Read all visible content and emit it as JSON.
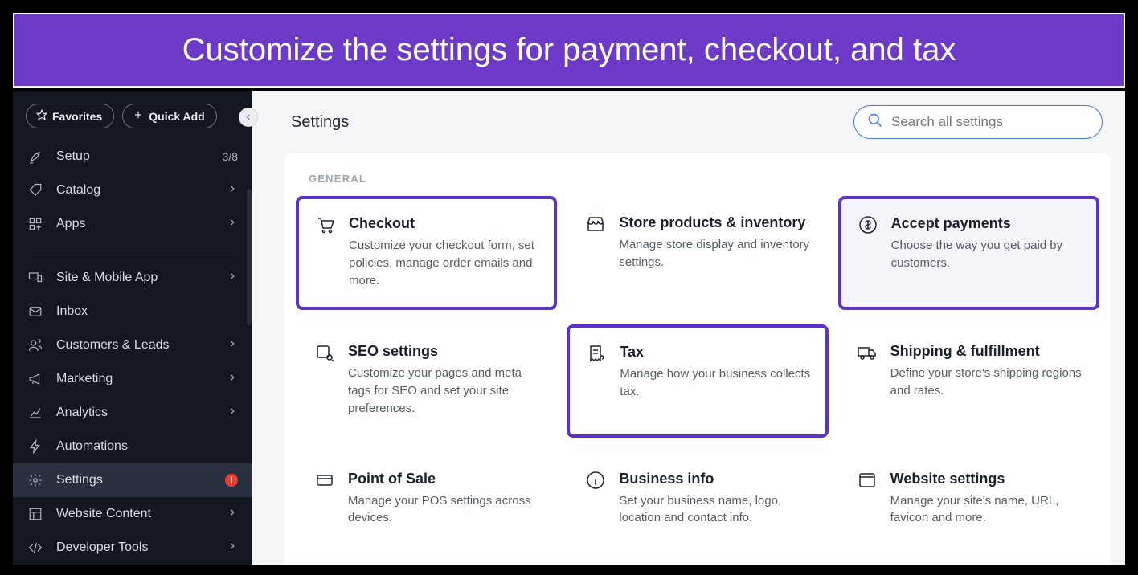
{
  "banner": "Customize the settings for payment, checkout, and tax",
  "pill_favorites": "Favorites",
  "pill_quickadd": "Quick Add",
  "sidebar": {
    "setup": {
      "label": "Setup",
      "meta": "3/8"
    },
    "catalog": {
      "label": "Catalog"
    },
    "apps": {
      "label": "Apps"
    },
    "siteapp": {
      "label": "Site & Mobile App"
    },
    "inbox": {
      "label": "Inbox"
    },
    "customers": {
      "label": "Customers & Leads"
    },
    "marketing": {
      "label": "Marketing"
    },
    "analytics": {
      "label": "Analytics"
    },
    "automations": {
      "label": "Automations"
    },
    "settings": {
      "label": "Settings",
      "alert": "!"
    },
    "websitecontent": {
      "label": "Website Content"
    },
    "devtools": {
      "label": "Developer Tools"
    }
  },
  "page": {
    "title": "Settings",
    "search_placeholder": "Search all settings",
    "section_general": "GENERAL"
  },
  "cards": {
    "checkout": {
      "title": "Checkout",
      "desc": "Customize your checkout form, set policies, manage order emails and more."
    },
    "store": {
      "title": "Store products & inventory",
      "desc": "Manage store display and inventory settings."
    },
    "payments": {
      "title": "Accept payments",
      "desc": "Choose the way you get paid by customers."
    },
    "seo": {
      "title": "SEO settings",
      "desc": "Customize your pages and meta tags for SEO and set your site preferences."
    },
    "tax": {
      "title": "Tax",
      "desc": "Manage how your business collects tax."
    },
    "shipping": {
      "title": "Shipping & fulfillment",
      "desc": "Define your store's shipping regions and rates."
    },
    "pos": {
      "title": "Point of Sale",
      "desc": "Manage your POS settings across devices."
    },
    "business": {
      "title": "Business info",
      "desc": "Set your business name, logo, location and contact info."
    },
    "website": {
      "title": "Website settings",
      "desc": "Manage your site's name, URL, favicon and more."
    }
  }
}
